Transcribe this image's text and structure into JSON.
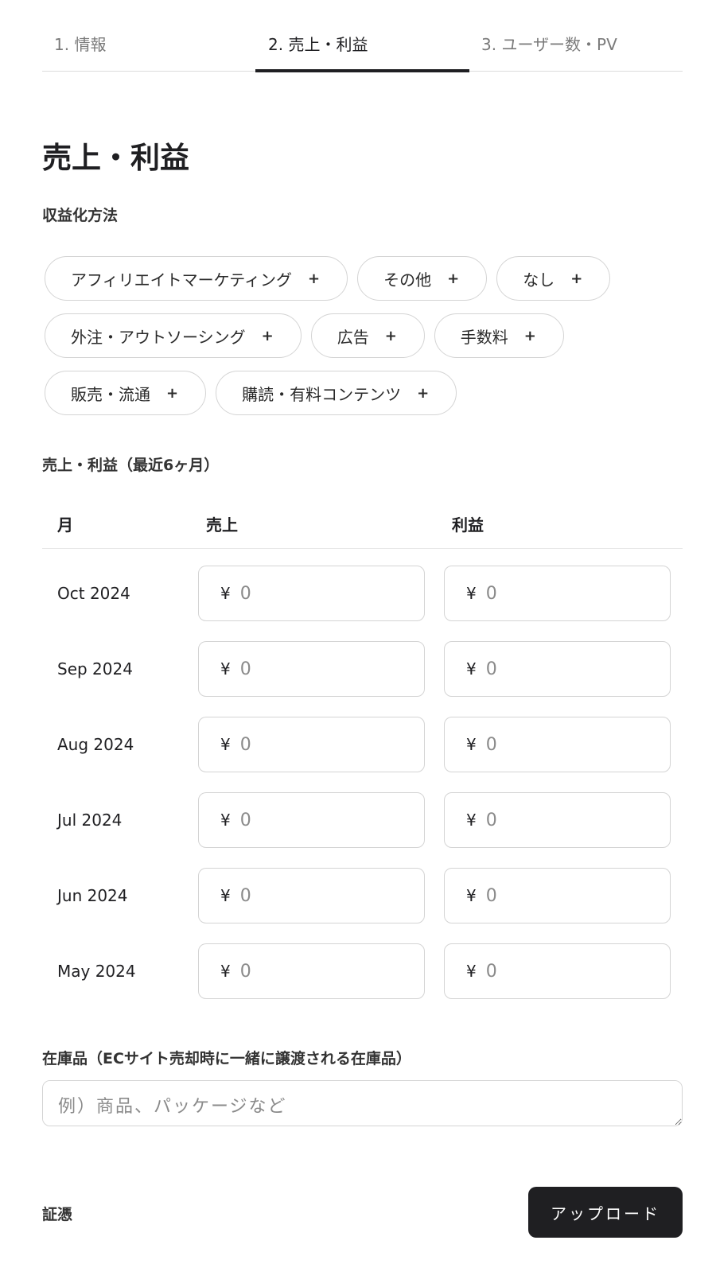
{
  "tabs": [
    {
      "label": "1. 情報",
      "active": false
    },
    {
      "label": "2. 売上・利益",
      "active": true
    },
    {
      "label": "3. ユーザー数・PV",
      "active": false
    }
  ],
  "page_title": "売上・利益",
  "monetization": {
    "label": "収益化方法",
    "chips": [
      {
        "label": "アフィリエイトマーケティング",
        "icon": "plus-icon"
      },
      {
        "label": "その他",
        "icon": "plus-icon"
      },
      {
        "label": "なし",
        "icon": "plus-icon"
      },
      {
        "label": "外注・アウトソーシング",
        "icon": "plus-icon"
      },
      {
        "label": "広告",
        "icon": "plus-icon"
      },
      {
        "label": "手数料",
        "icon": "plus-icon"
      },
      {
        "label": "販売・流通",
        "icon": "plus-icon"
      },
      {
        "label": "購読・有料コンテンツ",
        "icon": "plus-icon"
      }
    ],
    "plus_glyph": "+"
  },
  "revenue_table": {
    "label": "売上・利益（最近6ヶ月）",
    "headers": {
      "month": "月",
      "sales": "売上",
      "profit": "利益"
    },
    "currency_symbol": "¥",
    "placeholder": "0",
    "rows": [
      {
        "month": "Oct 2024",
        "sales": "",
        "profit": ""
      },
      {
        "month": "Sep 2024",
        "sales": "",
        "profit": ""
      },
      {
        "month": "Aug 2024",
        "sales": "",
        "profit": ""
      },
      {
        "month": "Jul 2024",
        "sales": "",
        "profit": ""
      },
      {
        "month": "Jun 2024",
        "sales": "",
        "profit": ""
      },
      {
        "month": "May 2024",
        "sales": "",
        "profit": ""
      }
    ]
  },
  "inventory": {
    "label": "在庫品（ECサイト売却時に一緒に譲渡される在庫品）",
    "placeholder": "例）商品、パッケージなど",
    "value": ""
  },
  "evidence": {
    "label": "証憑",
    "upload_button": "アップロード"
  }
}
